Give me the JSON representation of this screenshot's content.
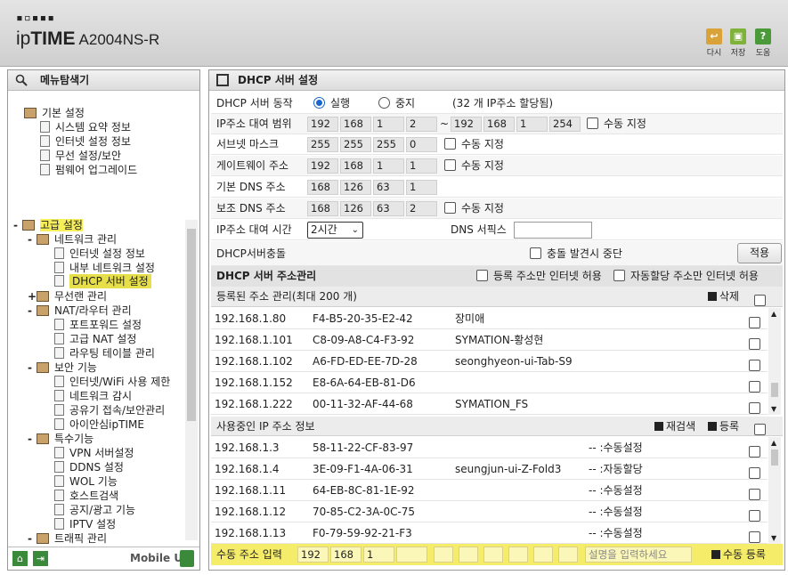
{
  "header": {
    "logo_dots": "▪▫▪▪▪",
    "brand_light": "ip",
    "brand_bold": "TIME",
    "model": "A2004NS-R",
    "buttons": [
      {
        "icon": "logout-icon",
        "label": "다시"
      },
      {
        "icon": "save-icon",
        "label": "저장"
      },
      {
        "icon": "help-icon",
        "label": "도움"
      }
    ]
  },
  "sidebar": {
    "title": "메뉴탐색기",
    "basic": {
      "label": "기본 설정",
      "items": [
        "시스템 요약 정보",
        "인터넷 설정 정보",
        "무선 설정/보안",
        "펌웨어 업그레이드"
      ]
    },
    "advanced": {
      "label": "고급 설정",
      "network": {
        "label": "네트워크 관리",
        "items": [
          "인터넷 설정 정보",
          "내부 네트워크 설정",
          "DHCP 서버 설정"
        ]
      },
      "wireless": "무선랜 관리",
      "nat": {
        "label": "NAT/라우터 관리",
        "items": [
          "포트포워드 설정",
          "고급 NAT 설정",
          "라우팅 테이블 관리"
        ]
      },
      "security": {
        "label": "보안 기능",
        "items": [
          "인터넷/WiFi 사용 제한",
          "네트워크 감시",
          "공유기 접속/보안관리",
          "아이안심ipTIME"
        ]
      },
      "special": {
        "label": "특수기능",
        "items": [
          "VPN 서버설정",
          "DDNS 설정",
          "WOL 기능",
          "호스트검색",
          "공지/광고 기능",
          "IPTV 설정"
        ]
      },
      "traffic": "트래픽 관리"
    },
    "mobile_ui": "Mobile UI"
  },
  "main": {
    "title": "DHCP 서버 설정",
    "dhcp_mode": {
      "label": "DHCP 서버 동작",
      "on": "실행",
      "off": "중지",
      "note": "(32 개 IP주소 할당됨)"
    },
    "range": {
      "label": "IP주소 대여 범위",
      "start": [
        "192",
        "168",
        "1",
        "2"
      ],
      "tilde": "~",
      "end": [
        "192",
        "168",
        "1",
        "254"
      ],
      "manual": "수동 지정"
    },
    "subnet": {
      "label": "서브넷 마스크",
      "value": [
        "255",
        "255",
        "255",
        "0"
      ],
      "manual": "수동 지정"
    },
    "gateway": {
      "label": "게이트웨이 주소",
      "value": [
        "192",
        "168",
        "1",
        "1"
      ],
      "manual": "수동 지정"
    },
    "dns1": {
      "label": "기본 DNS 주소",
      "value": [
        "168",
        "126",
        "63",
        "1"
      ]
    },
    "dns2": {
      "label": "보조 DNS 주소",
      "value": [
        "168",
        "126",
        "63",
        "2"
      ],
      "manual": "수동 지정"
    },
    "lease": {
      "label": "IP주소 대여 시간",
      "value": "2시간",
      "dns_suffix_label": "DNS 서픽스",
      "dns_suffix_value": ""
    },
    "conflict": {
      "label": "DHCP서버충돌",
      "stop": "충돌 발견시 중단",
      "apply": "적용"
    },
    "addr_mgmt": {
      "title": "DHCP 서버 주소관리",
      "reg_only": "등록 주소만 인터넷 허용",
      "auto_only": "자동할당 주소만 인터넷 허용"
    },
    "registered": {
      "title": "등록된 주소 관리(최대 200 개)",
      "delete": "삭제",
      "rows": [
        [
          "192.168.1.80",
          "F4-B5-20-35-E2-42",
          "장미애"
        ],
        [
          "192.168.1.101",
          "C8-09-A8-C4-F3-92",
          "SYMATION-황성현"
        ],
        [
          "192.168.1.102",
          "A6-FD-ED-EE-7D-28",
          "seonghyeon-ui-Tab-S9"
        ],
        [
          "192.168.1.152",
          "E8-6A-64-EB-81-D6",
          ""
        ],
        [
          "192.168.1.222",
          "00-11-32-AF-44-68",
          "SYMATION_FS"
        ]
      ]
    },
    "inuse": {
      "title": "사용중인 IP 주소 정보",
      "rescan": "재검색",
      "register": "등록",
      "rows": [
        [
          "192.168.1.3",
          "58-11-22-CF-83-97",
          "",
          "-- :수동설정"
        ],
        [
          "192.168.1.4",
          "3E-09-F1-4A-06-31",
          "seungjun-ui-Z-Fold3",
          "-- :자동할당"
        ],
        [
          "192.168.1.11",
          "64-EB-8C-81-1E-92",
          "",
          "-- :수동설정"
        ],
        [
          "192.168.1.12",
          "70-85-C2-3A-0C-75",
          "",
          "-- :수동설정"
        ],
        [
          "192.168.1.13",
          "F0-79-59-92-21-F3",
          "",
          "-- :수동설정"
        ]
      ]
    },
    "manual_input": {
      "label": "수동 주소 입력",
      "ip": [
        "192",
        "168",
        "1",
        ""
      ],
      "desc_placeholder": "설명을 입력하세요",
      "register": "수동 등록"
    }
  }
}
